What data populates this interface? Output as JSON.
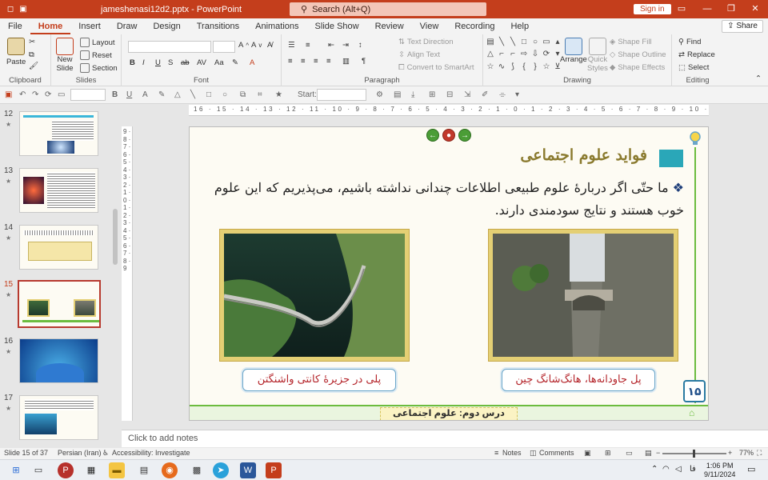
{
  "window": {
    "doc_title": "jameshenasi12d2.pptx - PowerPoint",
    "search_placeholder": "Search (Alt+Q)",
    "sign_in": "Sign in"
  },
  "ribbon_tabs": [
    "File",
    "Home",
    "Insert",
    "Draw",
    "Design",
    "Transitions",
    "Animations",
    "Slide Show",
    "Review",
    "View",
    "Recording",
    "Help"
  ],
  "active_tab": "Home",
  "share_label": "Share",
  "ribbon": {
    "clipboard": {
      "label": "Clipboard",
      "paste": "Paste"
    },
    "slides": {
      "label": "Slides",
      "new_slide": "New",
      "new_slide2": "Slide",
      "layout": "Layout",
      "reset": "Reset",
      "section": "Section"
    },
    "font": {
      "label": "Font"
    },
    "paragraph": {
      "label": "Paragraph",
      "text_direction": "Text Direction",
      "align_text": "Align Text",
      "convert_smartart": "Convert to SmartArt"
    },
    "drawing": {
      "label": "Drawing",
      "arrange": "Arrange",
      "quick_styles": "Quick",
      "quick_styles2": "Styles",
      "shape_fill": "Shape Fill",
      "shape_outline": "Shape Outline",
      "shape_effects": "Shape Effects"
    },
    "editing": {
      "label": "Editing",
      "find": "Find",
      "replace": "Replace",
      "select": "Select"
    }
  },
  "secondary_toolbar": {
    "start_label": "Start:"
  },
  "thumbnails": [
    {
      "num": "12",
      "star": "★"
    },
    {
      "num": "13",
      "star": "★"
    },
    {
      "num": "14",
      "star": "★"
    },
    {
      "num": "15",
      "star": "★"
    },
    {
      "num": "16",
      "star": "★"
    },
    {
      "num": "17",
      "star": "★"
    }
  ],
  "active_thumbnail": "15",
  "ruler_h": "16 · 15 · 14 · 13 · 12 · 11 · 10 · 9 · 8 · 7 · 6 · 5 · 4 · 3 · 2 · 1 · 0 · 1 · 2 · 3 · 4 · 5 · 6 · 7 · 8 · 9 · 10 · 11 · 12 · 13 · 14 · 15 · 16",
  "ruler_v": "9 · 8 · 7 · 6 · 5 · 4 · 3 · 2 · 1 · 0 · 1 · 2 · 3 · 4 · 5 · 6 · 7 · 8 · 9",
  "slide": {
    "title": "فواید علوم اجتماعی",
    "bullet": "❖",
    "body": "ما حتّی اگر دربارهٔ علوم طبیعی اطلاعات چندانی نداشته باشیم، می‌پذیریم که این علوم خوب هستند و نتایج سودمندی دارند.",
    "caption_left": "پلی در جزیرهٔ کانتی واشنگتن",
    "caption_right": "پل جاودانه‌ها، هانگ‌شانگ چین",
    "page_number": "۱۵",
    "footer_label": "درس دوم: علوم اجتماعی"
  },
  "notes_placeholder": "Click to add notes",
  "status": {
    "slide_of": "Slide 15 of 37",
    "language": "Persian (Iran)",
    "accessibility": "Accessibility: Investigate",
    "notes": "Notes",
    "comments": "Comments",
    "zoom": "77%"
  },
  "taskbar": {
    "time": "1:06 PM",
    "date": "9/11/2024",
    "lang": "فا"
  },
  "colors": {
    "accent": "#c43e1c",
    "slide_green": "#6cbc3f",
    "caption_red": "#b4242a",
    "teal": "#2aa7b8"
  }
}
